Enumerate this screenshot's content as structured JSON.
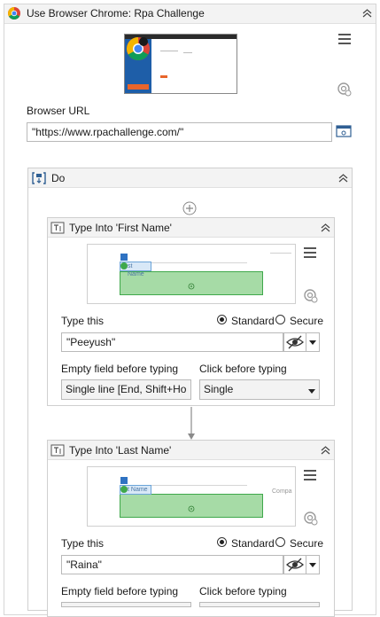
{
  "window": {
    "title": "Use Browser Chrome: Rpa Challenge"
  },
  "browser": {
    "url_label": "Browser URL",
    "url_value": "\"https://www.rpachallenge.com/\""
  },
  "do_block": {
    "title": "Do"
  },
  "activities": [
    {
      "title": "Type Into 'First Name'",
      "preview_anchor_text": "st Name",
      "type_this_label": "Type this",
      "option_standard": "Standard",
      "option_secure": "Secure",
      "value": "\"Peeyush\"",
      "empty_field_label": "Empty field before typing",
      "empty_field_value": "Single line [End, Shift+Ho",
      "click_before_label": "Click before typing",
      "click_before_value": "Single"
    },
    {
      "title": "Type Into 'Last Name'",
      "preview_anchor_text": "t Name",
      "preview_side_text": "Compa",
      "type_this_label": "Type this",
      "option_standard": "Standard",
      "option_secure": "Secure",
      "value": "\"Raina\"",
      "empty_field_label": "Empty field before typing",
      "click_before_label": "Click before typing"
    }
  ],
  "icons": [
    "chrome-icon",
    "collapse-chevron-icon",
    "menu-icon",
    "target-icon",
    "browser-window-icon",
    "plus-icon",
    "type-into-icon",
    "eye-slash-icon",
    "dropdown-arrow-icon",
    "arrow-down-icon",
    "anchor-icon"
  ],
  "colors": {
    "header_bg": "#f3f3f3",
    "selection_green": "#a6dba6",
    "anchor_blue": "#d8e8f7",
    "connector": "#8a8a8a"
  }
}
